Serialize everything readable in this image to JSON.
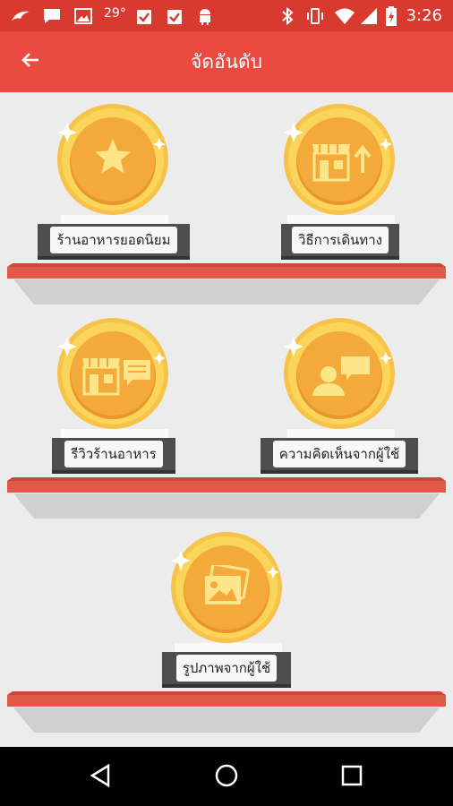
{
  "status_bar": {
    "temperature": "29°",
    "time": "3:26",
    "icons": [
      "bird-app-icon",
      "message-icon",
      "image-icon",
      "clipboard-check-icon",
      "clipboard-check-icon",
      "android-icon",
      "bluetooth-icon",
      "vibrate-icon",
      "wifi-icon",
      "cell-signal-icon",
      "battery-charging-icon"
    ]
  },
  "app_bar": {
    "title": "จัดอันดับ",
    "back_icon": "arrow-left-icon"
  },
  "trophies": [
    {
      "label": "ร้านอาหารยอดนิยม",
      "icon": "star-icon"
    },
    {
      "label": "วิธีการเดินทาง",
      "icon": "shop-upload-icon"
    },
    {
      "label": "รีวิวร้านอาหาร",
      "icon": "shop-review-icon"
    },
    {
      "label": "ความคิดเห็นจากผู้ใช้",
      "icon": "user-comment-icon"
    },
    {
      "label": "รูปภาพจากผู้ใช้",
      "icon": "photos-icon"
    }
  ],
  "nav_bar": {
    "back_icon": "nav-back-icon",
    "home_icon": "nav-home-icon",
    "recents_icon": "nav-recents-icon"
  },
  "colors": {
    "status_bar": "#d93a30",
    "app_bar": "#ea4a40",
    "medal_gold": "#f3a73a",
    "shelf_red": "#dd5a44"
  }
}
